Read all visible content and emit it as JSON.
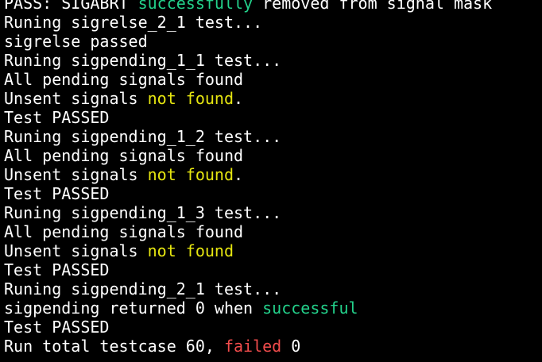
{
  "colors": {
    "background": "#000000",
    "default": "#ffffff",
    "green": "#23d18b",
    "yellow": "#e5e510",
    "red": "#f14c4c"
  },
  "terminal": {
    "lines": [
      [
        {
          "text": "PASS: SIGABRT ",
          "color": "default"
        },
        {
          "text": "successfully",
          "color": "green"
        },
        {
          "text": " removed from signal mask",
          "color": "default"
        }
      ],
      [
        {
          "text": "Runing sigrelse_2_1 test...",
          "color": "default"
        }
      ],
      [
        {
          "text": "sigrelse passed",
          "color": "default"
        }
      ],
      [
        {
          "text": "Runing sigpending_1_1 test...",
          "color": "default"
        }
      ],
      [
        {
          "text": "All pending signals found",
          "color": "default"
        }
      ],
      [
        {
          "text": "Unsent signals ",
          "color": "default"
        },
        {
          "text": "not found",
          "color": "yellow"
        },
        {
          "text": ".",
          "color": "default"
        }
      ],
      [
        {
          "text": "Test PASSED",
          "color": "default"
        }
      ],
      [
        {
          "text": "Runing sigpending_1_2 test...",
          "color": "default"
        }
      ],
      [
        {
          "text": "All pending signals found",
          "color": "default"
        }
      ],
      [
        {
          "text": "Unsent signals ",
          "color": "default"
        },
        {
          "text": "not found",
          "color": "yellow"
        },
        {
          "text": ".",
          "color": "default"
        }
      ],
      [
        {
          "text": "Test PASSED",
          "color": "default"
        }
      ],
      [
        {
          "text": "Runing sigpending_1_3 test...",
          "color": "default"
        }
      ],
      [
        {
          "text": "All pending signals found",
          "color": "default"
        }
      ],
      [
        {
          "text": "Unsent signals ",
          "color": "default"
        },
        {
          "text": "not found",
          "color": "yellow"
        }
      ],
      [
        {
          "text": "Test PASSED",
          "color": "default"
        }
      ],
      [
        {
          "text": "Runing sigpending_2_1 test...",
          "color": "default"
        }
      ],
      [
        {
          "text": "sigpending returned 0 when ",
          "color": "default"
        },
        {
          "text": "successful",
          "color": "green"
        }
      ],
      [
        {
          "text": "Test PASSED",
          "color": "default"
        }
      ],
      [
        {
          "text": "Run total testcase 60, ",
          "color": "default"
        },
        {
          "text": "failed",
          "color": "red"
        },
        {
          "text": " 0",
          "color": "default"
        }
      ]
    ]
  }
}
